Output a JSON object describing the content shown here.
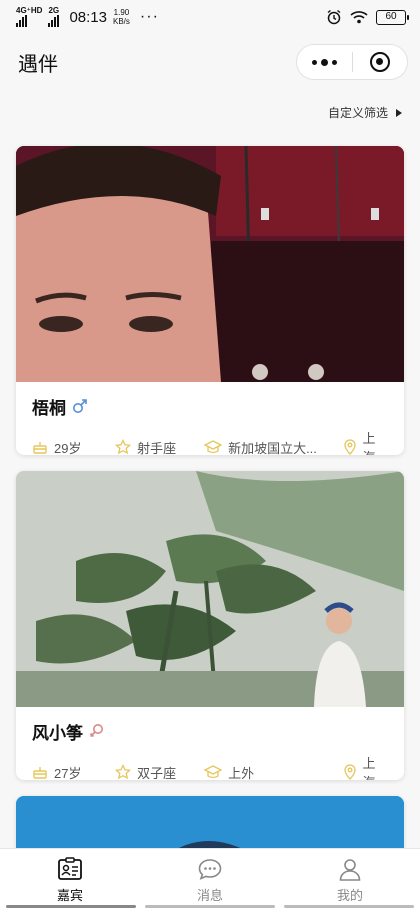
{
  "status": {
    "network": "4G⁺HD",
    "network2": "2G",
    "time": "08:13",
    "speed_value": "1.90",
    "speed_unit": "KB/s",
    "more": "···",
    "battery": "60"
  },
  "nav": {
    "title": "遇伴"
  },
  "filter": {
    "label": "自定义筛选"
  },
  "cards": [
    {
      "name": "梧桐",
      "gender": "male",
      "age": "29岁",
      "zodiac": "射手座",
      "school": "新加坡国立大...",
      "city": "上海"
    },
    {
      "name": "风小筝",
      "gender": "female",
      "age": "27岁",
      "zodiac": "双子座",
      "school": "上外",
      "city": "上海"
    }
  ],
  "tabs": [
    {
      "label": "嘉宾",
      "active": true
    },
    {
      "label": "消息",
      "active": false
    },
    {
      "label": "我的",
      "active": false
    }
  ],
  "colors": {
    "male": "#5a8fd6",
    "female": "#d98a8a",
    "meta_icon": "#e5c65a"
  }
}
